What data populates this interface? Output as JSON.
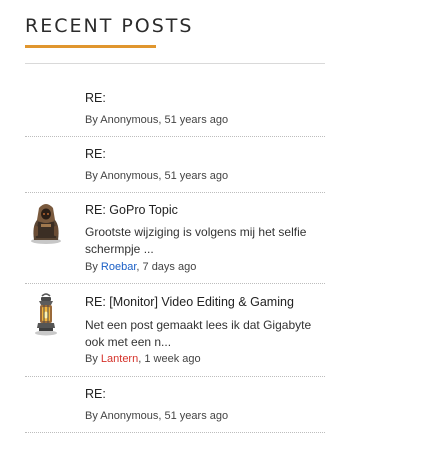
{
  "widget": {
    "title": "RECENT POSTS"
  },
  "posts": [
    {
      "title": "RE:",
      "excerpt": "",
      "by": "By ",
      "author": "Anonymous",
      "sep": ", ",
      "time": "51 years ago",
      "avatar": "none"
    },
    {
      "title": "RE:",
      "excerpt": "",
      "by": "By ",
      "author": "Anonymous",
      "sep": ", ",
      "time": "51 years ago",
      "avatar": "none"
    },
    {
      "title": "RE: GoPro Topic",
      "excerpt": "Grootste wijziging is volgens mij het selfie schermpje ...",
      "by": "By ",
      "author": "Roebar",
      "sep": ", ",
      "time": "7 days ago",
      "avatar": "hooded-warrior-avatar"
    },
    {
      "title": "RE: [Monitor] Video Editing & Gaming",
      "excerpt": "Net een post gemaakt lees ik dat Gigabyte ook met een n...",
      "by": "By ",
      "author": "Lantern",
      "sep": ", ",
      "time": "1 week ago",
      "avatar": "lantern-avatar"
    },
    {
      "title": "RE:",
      "excerpt": "",
      "by": "By ",
      "author": "Anonymous",
      "sep": ", ",
      "time": "51 years ago",
      "avatar": "none"
    }
  ],
  "colors": {
    "accent_underline": "#e0962e",
    "author_link_blue": "#1a5fc6",
    "author_link_red": "#d5322a"
  }
}
